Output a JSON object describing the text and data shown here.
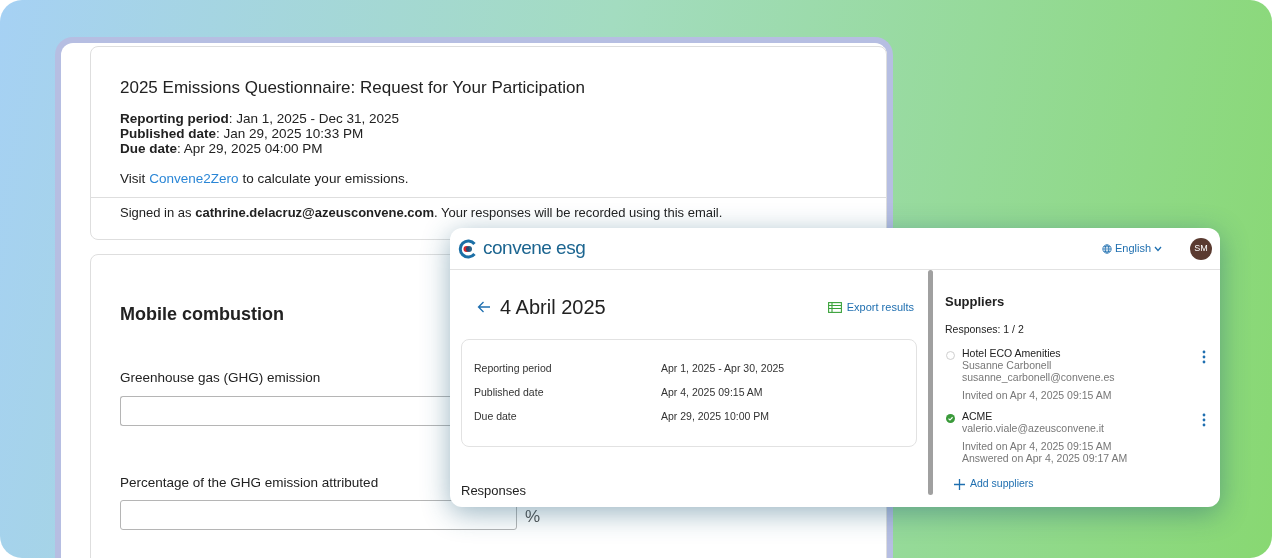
{
  "form": {
    "title": "2025 Emissions Questionnaire: Request for Your Participation",
    "details": [
      {
        "label": "Reporting period",
        "value": ": Jan 1, 2025 - Dec 31, 2025"
      },
      {
        "label": "Published date",
        "value": ": Jan 29, 2025 10:33 PM"
      },
      {
        "label": "Due date",
        "value": ": Apr 29, 2025 04:00 PM"
      }
    ],
    "visit": {
      "before": "Visit",
      "link": "Convene2Zero",
      "after": "to calculate your emissions."
    },
    "signed_in": "Signed in as **cathrine.delacruz@azeusconvene.com**. Your responses will be recorded using this email."
  },
  "section": {
    "title": "Mobile combustion",
    "fields": [
      {
        "label": "Greenhouse gas (GHG) emission"
      },
      {
        "label": "Percentage of the GHG emission attributed",
        "unit": "%"
      }
    ]
  },
  "app": {
    "logo": "convene esg",
    "language": "English",
    "avatar": "SM",
    "title": "4 Abril 2025",
    "export": "Export results",
    "details": [
      {
        "label": "Reporting period",
        "value": "Apr 1, 2025 - Apr 30, 2025"
      },
      {
        "label": "Published date",
        "value": "Apr 4, 2025 09:15 AM"
      },
      {
        "label": "Due date",
        "value": "Apr 29, 2025 10:00 PM"
      }
    ],
    "responses_heading": "Responses",
    "suppliers": {
      "title": "Suppliers",
      "count": "Responses: 1 / 2",
      "items": [
        {
          "name": "Hotel ECO Amenities",
          "contacts": [
            "Susanne Carbonell",
            "susanne_carbonell@convene.es"
          ],
          "dates": [
            "Invited on Apr 4, 2025 09:15 AM"
          ],
          "answered": false
        },
        {
          "name": "ACME",
          "contacts": [
            "valerio.viale@azeusconvene.it"
          ],
          "dates": [
            "Invited on Apr 4, 2025 09:15 AM",
            "Answered on Apr 4, 2025 09:17 AM"
          ],
          "answered": true
        }
      ],
      "add": "Add suppliers"
    }
  }
}
